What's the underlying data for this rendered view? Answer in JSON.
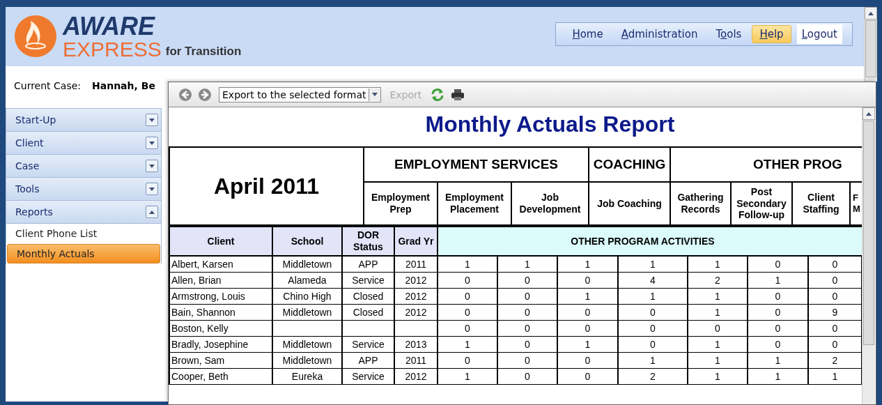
{
  "header": {
    "logo_top": "AWARE",
    "logo_bottom": "EXPRESS",
    "subtitle": "for Transition"
  },
  "nav": [
    {
      "kind": "link",
      "key": "H",
      "post": "ome",
      "selected": false
    },
    {
      "kind": "link",
      "key": "A",
      "post": "dministration",
      "selected": false
    },
    {
      "kind": "link",
      "pre": "T",
      "key": "o",
      "post": "ols",
      "selected": false
    },
    {
      "kind": "link",
      "key": "H",
      "post": "elp",
      "selected": true
    },
    {
      "kind": "button",
      "key": "L",
      "post": "ogout",
      "selected": false
    }
  ],
  "current_case": {
    "label": "Current Case:",
    "value": "Hannah, Be"
  },
  "sidebar": [
    {
      "label": "Start-Up",
      "expanded": false
    },
    {
      "label": "Client",
      "expanded": false
    },
    {
      "label": "Case",
      "expanded": false
    },
    {
      "label": "Tools",
      "expanded": false
    },
    {
      "label": "Reports",
      "expanded": true,
      "children": [
        {
          "label": "Client Phone List",
          "selected": false
        },
        {
          "label": "Monthly Actuals",
          "selected": true
        }
      ]
    }
  ],
  "viewer": {
    "format_select": "Export to the selected format",
    "export": {
      "label": "Export",
      "disabled": true
    },
    "report": {
      "title": "Monthly Actuals Report",
      "period": "April 2011",
      "groups": [
        {
          "label": "EMPLOYMENT SERVICES",
          "columns": [
            "Employment Prep",
            "Employment Placement",
            "Job Development"
          ]
        },
        {
          "label": "COACHING",
          "columns": [
            "Job Coaching"
          ]
        },
        {
          "label": "OTHER PROG",
          "columns": [
            "Gathering Records",
            "Post Secondary Follow-up",
            "Client Staffing",
            "F M"
          ]
        }
      ],
      "columns": [
        "Client",
        "School",
        "DOR Status",
        "Grad Yr"
      ],
      "section": "OTHER PROGRAM ACTIVITIES",
      "rows": [
        {
          "client": "Albert, Karsen",
          "school": "Middletown",
          "status": "APP",
          "grad": "2011",
          "values": [
            "1",
            "1",
            "1",
            "1",
            "1",
            "0",
            "0"
          ]
        },
        {
          "client": "Allen, Brian",
          "school": "Alameda",
          "status": "Service",
          "grad": "2012",
          "values": [
            "0",
            "0",
            "0",
            "4",
            "2",
            "1",
            "0"
          ]
        },
        {
          "client": "Armstrong, Louis",
          "school": "Chino High",
          "status": "Closed",
          "grad": "2012",
          "values": [
            "0",
            "0",
            "1",
            "1",
            "1",
            "0",
            "0"
          ]
        },
        {
          "client": "Bain, Shannon",
          "school": "Middletown",
          "status": "Closed",
          "grad": "2012",
          "values": [
            "0",
            "0",
            "0",
            "0",
            "1",
            "0",
            "9"
          ]
        },
        {
          "client": "Boston, Kelly",
          "values": [
            "0",
            "0",
            "0",
            "0",
            "0",
            "0",
            "0"
          ]
        },
        {
          "client": "Bradly, Josephine",
          "school": "Middletown",
          "status": "Service",
          "grad": "2013",
          "values": [
            "1",
            "0",
            "1",
            "0",
            "1",
            "0",
            "0"
          ]
        },
        {
          "client": "Brown, Sam",
          "school": "Middletown",
          "status": "APP",
          "grad": "2011",
          "values": [
            "0",
            "0",
            "0",
            "1",
            "1",
            "1",
            "2"
          ]
        },
        {
          "client": "Cooper, Beth",
          "school": "Eureka",
          "status": "Service",
          "grad": "2012",
          "values": [
            "1",
            "0",
            "0",
            "2",
            "1",
            "1",
            "1"
          ]
        }
      ]
    }
  }
}
